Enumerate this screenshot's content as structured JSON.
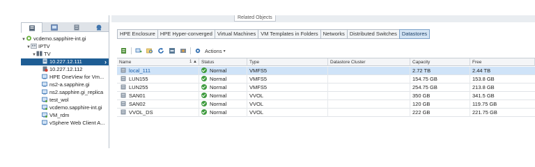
{
  "navigator": {
    "tabs": [
      {
        "icon": "hosts-and-clusters-icon"
      },
      {
        "icon": "vms-and-templates-icon"
      },
      {
        "icon": "storage-icon"
      },
      {
        "icon": "networking-icon"
      }
    ],
    "tree": [
      {
        "label": "vcdemo.sapphire-int.gi",
        "icon": "vcenter-icon",
        "expanded": true
      },
      {
        "label": "IPTV",
        "icon": "datacenter-icon",
        "expanded": true
      },
      {
        "label": "TV",
        "icon": "cluster-icon",
        "expanded": true
      },
      {
        "label": "10.227.12.111",
        "icon": "host-icon",
        "selected": true
      },
      {
        "label": "10.227.12.112",
        "icon": "host-error-icon"
      },
      {
        "label": "HPE OneView for Vm...",
        "icon": "vm-icon"
      },
      {
        "label": "ns2-a.sapphire.gi",
        "icon": "vm-icon"
      },
      {
        "label": "ns2.sapphire.gi_replica",
        "icon": "vm-icon"
      },
      {
        "label": "test_wol",
        "icon": "vm-icon"
      },
      {
        "label": "vcdemo.sapphire-int.gi",
        "icon": "vm-icon"
      },
      {
        "label": "VM_rdm",
        "icon": "vm-icon"
      },
      {
        "label": "vSphere Web Client A...",
        "icon": "vm-icon"
      }
    ]
  },
  "main": {
    "related_tab": "Related Objects",
    "subtabs": [
      {
        "label": "HPE Enclosure",
        "active": false
      },
      {
        "label": "HPE Hyper-converged",
        "active": false
      },
      {
        "label": "Virtual Machines",
        "active": false
      },
      {
        "label": "VM Templates in Folders",
        "active": false
      },
      {
        "label": "Networks",
        "active": false
      },
      {
        "label": "Distributed Switches",
        "active": false
      },
      {
        "label": "Datastores",
        "active": true
      }
    ],
    "toolbar": {
      "buttons": [
        "new-datastore-icon",
        "register-vm-icon",
        "browse-files-icon",
        "refresh-icon",
        "increase-capacity-icon",
        "mount-icon",
        "settings-icon"
      ],
      "actions_label": "Actions"
    },
    "grid": {
      "columns": [
        "Name",
        "Status",
        "Type",
        "Datastore Cluster",
        "Capacity",
        "Free"
      ],
      "sort_indicator": "1 ▲",
      "rows": [
        {
          "name": "local_111",
          "status": "Normal",
          "type": "VMFS5",
          "cluster": "",
          "capacity": "2.72 TB",
          "free": "2.44 TB",
          "selected": true
        },
        {
          "name": "LUN155",
          "status": "Normal",
          "type": "VMFS5",
          "cluster": "",
          "capacity": "154.75 GB",
          "free": "153.8 GB"
        },
        {
          "name": "LUN255",
          "status": "Normal",
          "type": "VMFS5",
          "cluster": "",
          "capacity": "254.75 GB",
          "free": "213.8 GB"
        },
        {
          "name": "SAN01",
          "status": "Normal",
          "type": "VVOL",
          "cluster": "",
          "capacity": "350 GB",
          "free": "341.5 GB"
        },
        {
          "name": "SAN02",
          "status": "Normal",
          "type": "VVOL",
          "cluster": "",
          "capacity": "120 GB",
          "free": "119.75 GB"
        },
        {
          "name": "VVOL_DS",
          "status": "Normal",
          "type": "VVOL",
          "cluster": "",
          "capacity": "222 GB",
          "free": "221.75 GB"
        }
      ]
    }
  },
  "colors": {
    "selection_nav": "#1e5d94",
    "selection_grid": "#cfe3f8",
    "status_ok": "#3f9b3f",
    "link": "#1a5ea8"
  }
}
